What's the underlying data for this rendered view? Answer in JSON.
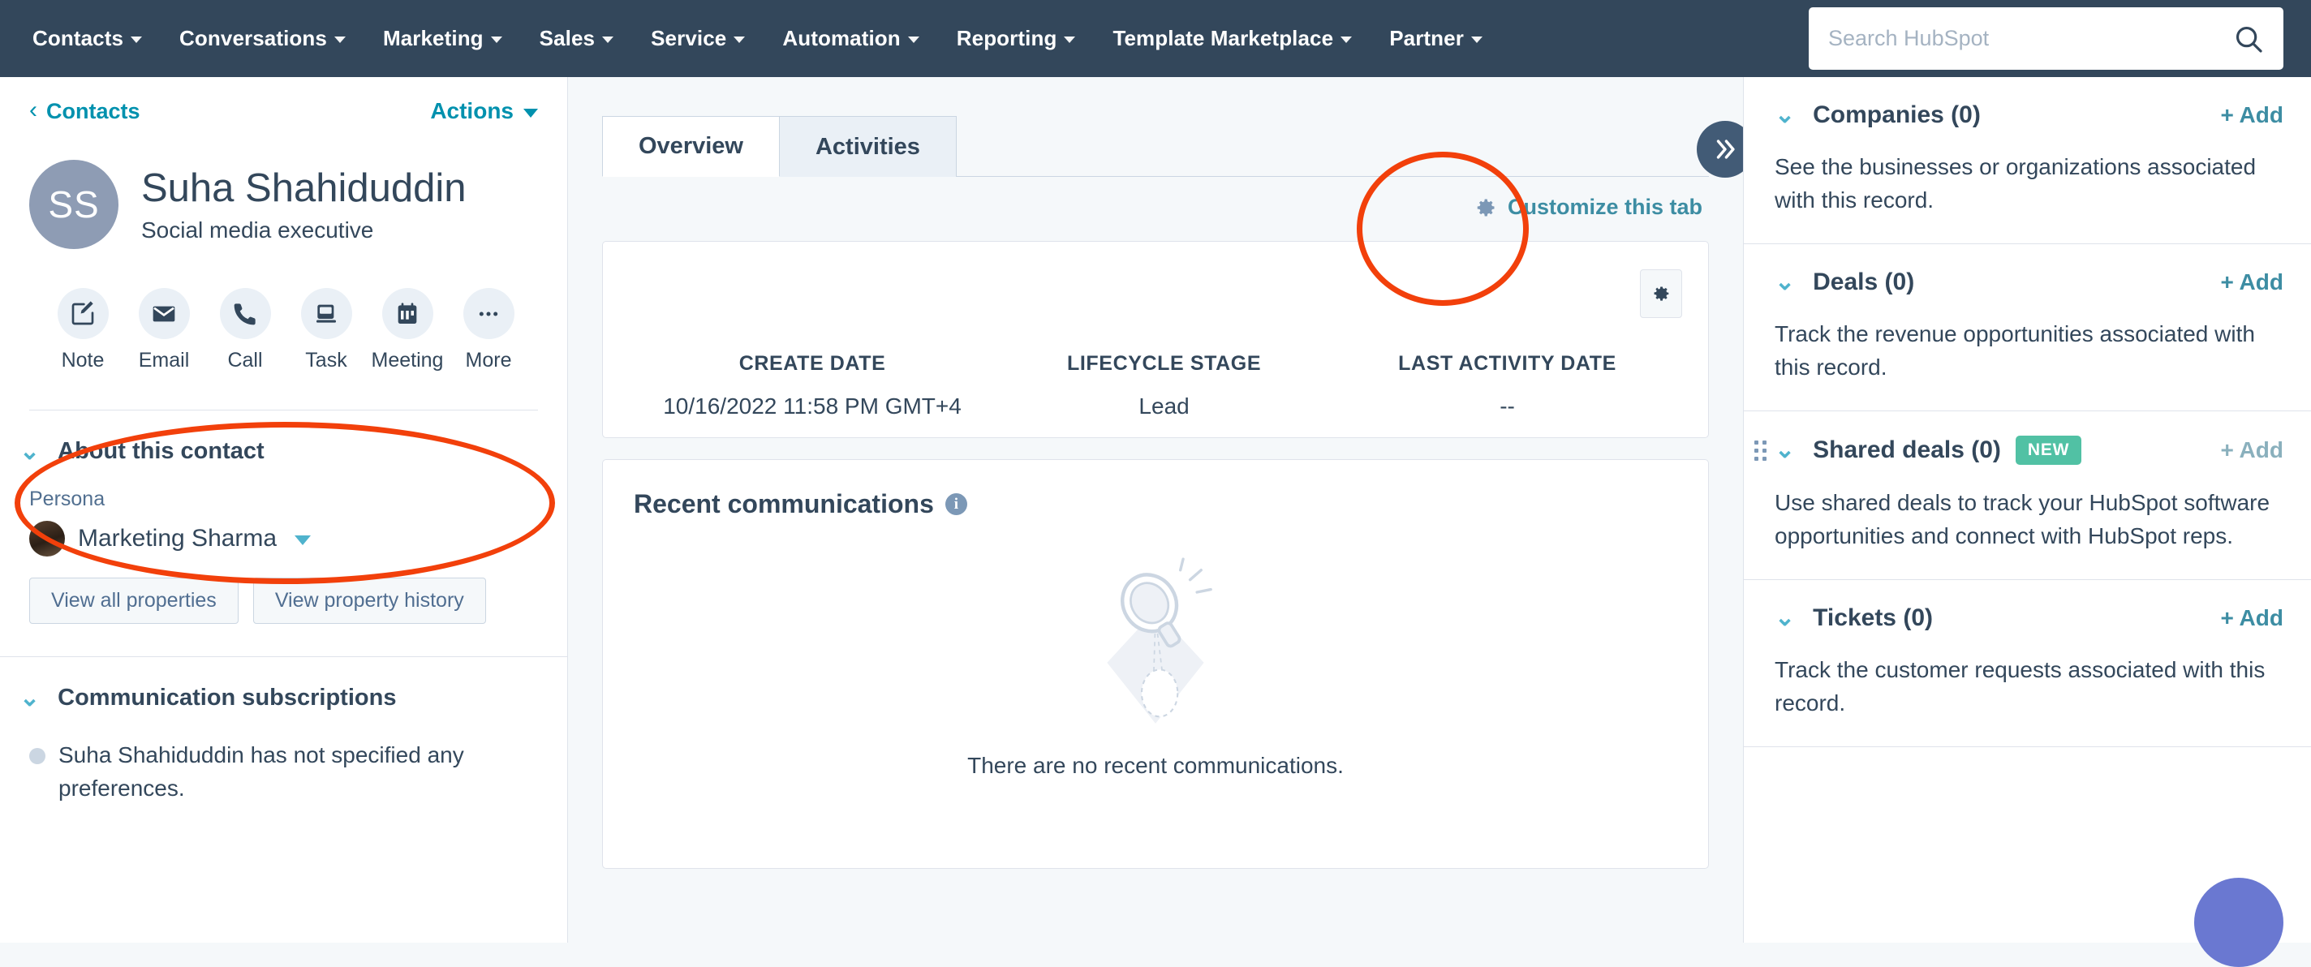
{
  "topnav": {
    "items": [
      {
        "label": "Contacts",
        "has_caret": true
      },
      {
        "label": "Conversations",
        "has_caret": true
      },
      {
        "label": "Marketing",
        "has_caret": true
      },
      {
        "label": "Sales",
        "has_caret": true
      },
      {
        "label": "Service",
        "has_caret": true
      },
      {
        "label": "Automation",
        "has_caret": true
      },
      {
        "label": "Reporting",
        "has_caret": true
      },
      {
        "label": "Template Marketplace",
        "has_caret": true
      },
      {
        "label": "Partner",
        "has_caret": true
      }
    ],
    "search": {
      "placeholder": "Search HubSpot",
      "value": "",
      "icon": "search-icon"
    },
    "background_color": "#33475b"
  },
  "left_panel": {
    "breadcrumb": "Contacts",
    "actions_label": "Actions",
    "avatar_initials": "SS",
    "avatar_color": "#8e9cb4",
    "contact_name": "Suha Shahiduddin",
    "contact_title": "Social media executive",
    "quick_actions": [
      {
        "label": "Note",
        "icon": "note-pencil-icon"
      },
      {
        "label": "Email",
        "icon": "envelope-icon"
      },
      {
        "label": "Call",
        "icon": "phone-icon"
      },
      {
        "label": "Task",
        "icon": "task-card-icon"
      },
      {
        "label": "Meeting",
        "icon": "calendar-icon"
      },
      {
        "label": "More",
        "icon": "ellipsis-icon"
      }
    ],
    "about": {
      "section_title": "About this contact",
      "persona_label": "Persona",
      "persona_value": "Marketing Sharma",
      "view_all_properties": "View all properties",
      "view_property_history": "View property history"
    },
    "subscriptions": {
      "section_title": "Communication subscriptions",
      "message": "Suha Shahiduddin has not specified any preferences."
    }
  },
  "center_panel": {
    "tabs": [
      {
        "label": "Overview",
        "active": true
      },
      {
        "label": "Activities",
        "active": false
      }
    ],
    "collapse_icon": "double-chevron-right-icon",
    "customize_link": "Customize this tab",
    "customize_icon": "gear-icon",
    "properties_card": {
      "settings_icon": "gear-icon",
      "stats": [
        {
          "key": "CREATE DATE",
          "value": "10/16/2022 11:58 PM GMT+4"
        },
        {
          "key": "LIFECYCLE STAGE",
          "value": "Lead"
        },
        {
          "key": "LAST ACTIVITY DATE",
          "value": "--"
        }
      ]
    },
    "recent_communications": {
      "title": "Recent communications",
      "info_icon": "info-icon",
      "empty_message": "There are no recent communications.",
      "empty_illustration": "magnifying-glass-illustration"
    }
  },
  "right_panel": {
    "sections": [
      {
        "title": "Companies (0)",
        "add_label": "+ Add",
        "description": "See the businesses or organizations associated with this record.",
        "badge": null,
        "has_drag_handle": false,
        "add_muted": false
      },
      {
        "title": "Deals (0)",
        "add_label": "+ Add",
        "description": "Track the revenue opportunities associated with this record.",
        "badge": null,
        "has_drag_handle": false,
        "add_muted": false
      },
      {
        "title": "Shared deals (0)",
        "add_label": "+ Add",
        "description": "Use shared deals to track your HubSpot software opportunities and connect with HubSpot reps.",
        "badge": "NEW",
        "badge_color": "#51c1a4",
        "has_drag_handle": true,
        "add_muted": true
      },
      {
        "title": "Tickets (0)",
        "add_label": "+ Add",
        "description": "Track the customer requests associated with this record.",
        "badge": null,
        "has_drag_handle": false,
        "add_muted": false
      }
    ],
    "chat_fab": {
      "color": "#6a78d1",
      "icon": "chat-bubble-icon"
    }
  },
  "annotations": {
    "color": "#f2400b",
    "shapes": [
      {
        "name": "quick-actions-highlight",
        "target": "quick-actions-row"
      },
      {
        "name": "activities-tab-highlight",
        "target": "tab-activities"
      }
    ]
  }
}
